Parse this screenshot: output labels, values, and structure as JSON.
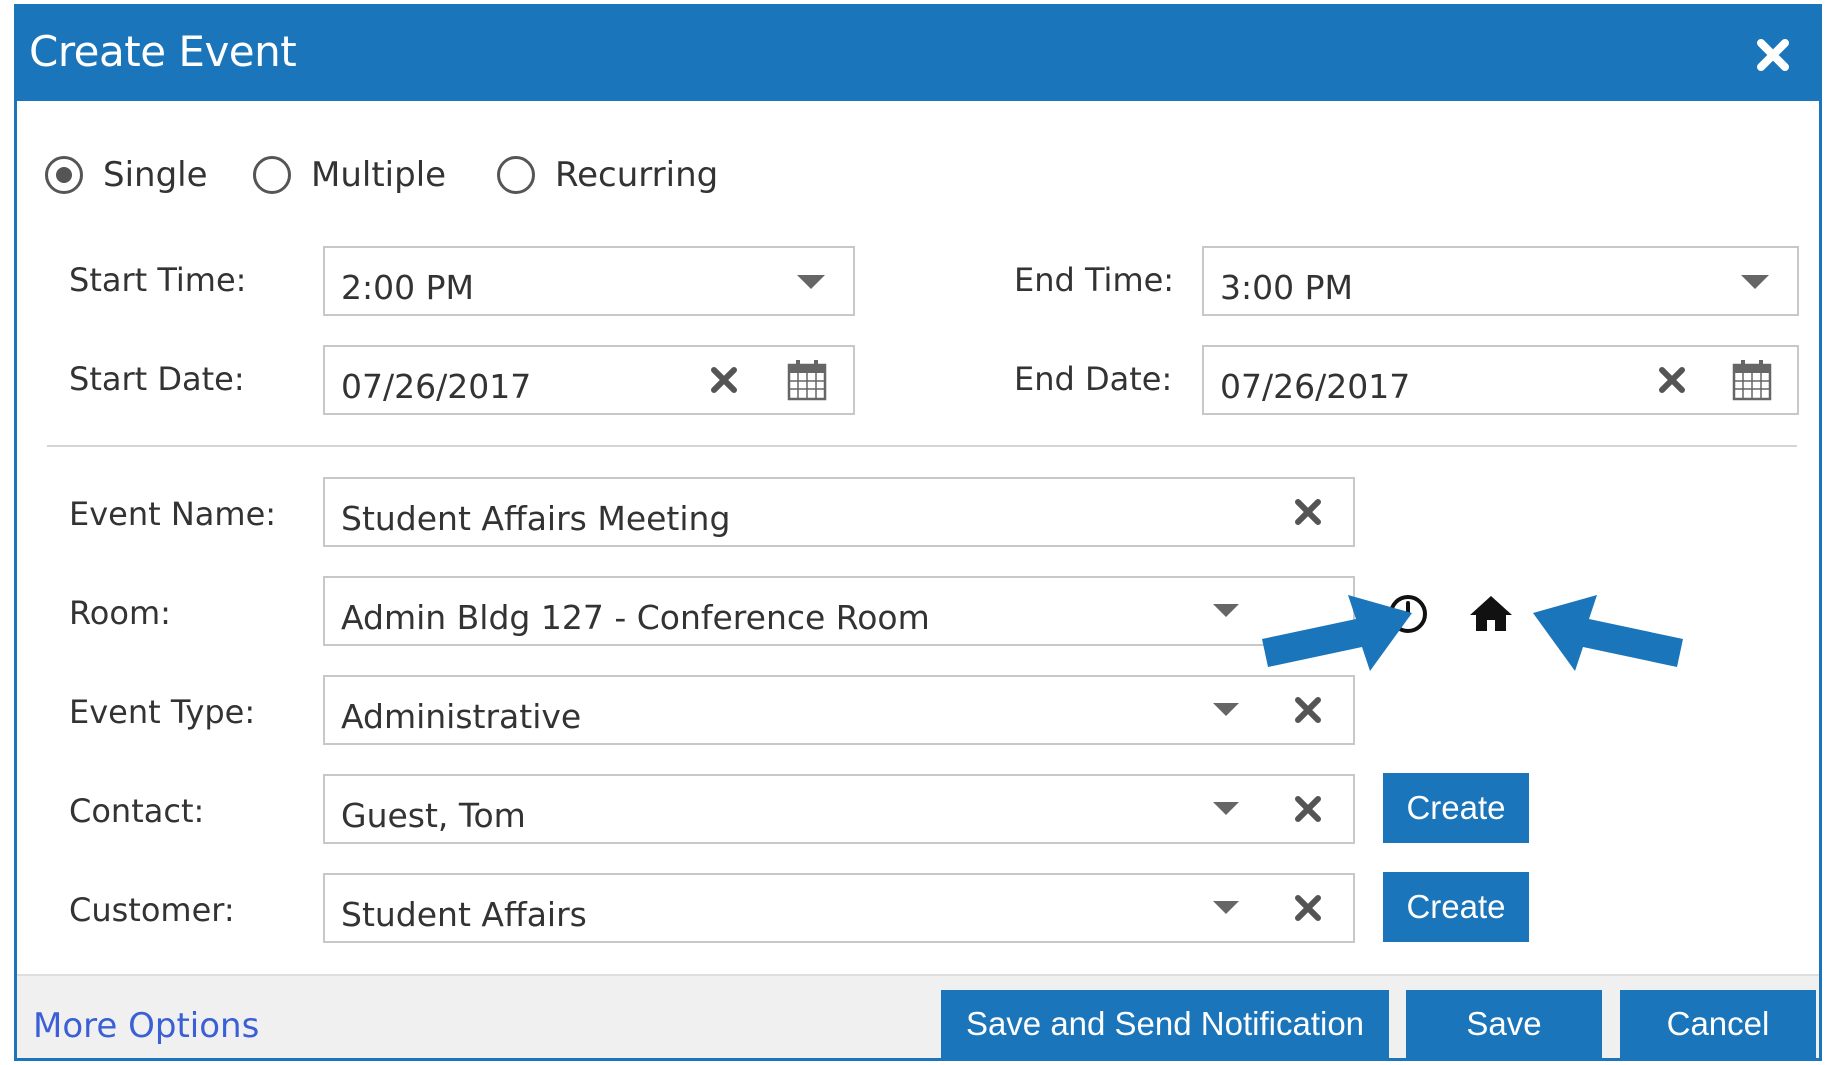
{
  "dialog": {
    "title": "Create Event"
  },
  "colors": {
    "primary": "#1b75bb",
    "link": "#3a5fd6",
    "footer_bg": "#f0f0f0"
  },
  "recurrence": {
    "options": [
      {
        "label": "Single",
        "checked": true
      },
      {
        "label": "Multiple",
        "checked": false
      },
      {
        "label": "Recurring",
        "checked": false
      }
    ]
  },
  "schedule": {
    "start_time_label": "Start Time:",
    "start_time_value": "2:00 PM",
    "end_time_label": "End Time:",
    "end_time_value": "3:00 PM",
    "start_date_label": "Start Date:",
    "start_date_value": "07/26/2017",
    "end_date_label": "End Date:",
    "end_date_value": "07/26/2017"
  },
  "details": {
    "event_name_label": "Event Name:",
    "event_name_value": "Student Affairs Meeting",
    "room_label": "Room:",
    "room_value": "Admin Bldg 127 - Conference Room",
    "event_type_label": "Event Type:",
    "event_type_value": "Administrative",
    "contact_label": "Contact:",
    "contact_value": "Guest, Tom",
    "contact_create_label": "Create",
    "customer_label": "Customer:",
    "customer_value": "Student Affairs",
    "customer_create_label": "Create"
  },
  "room_icons": [
    "clock-icon",
    "home-icon"
  ],
  "footer": {
    "more_options_label": "More Options",
    "save_notify_label": "Save and Send Notification",
    "save_label": "Save",
    "cancel_label": "Cancel"
  }
}
